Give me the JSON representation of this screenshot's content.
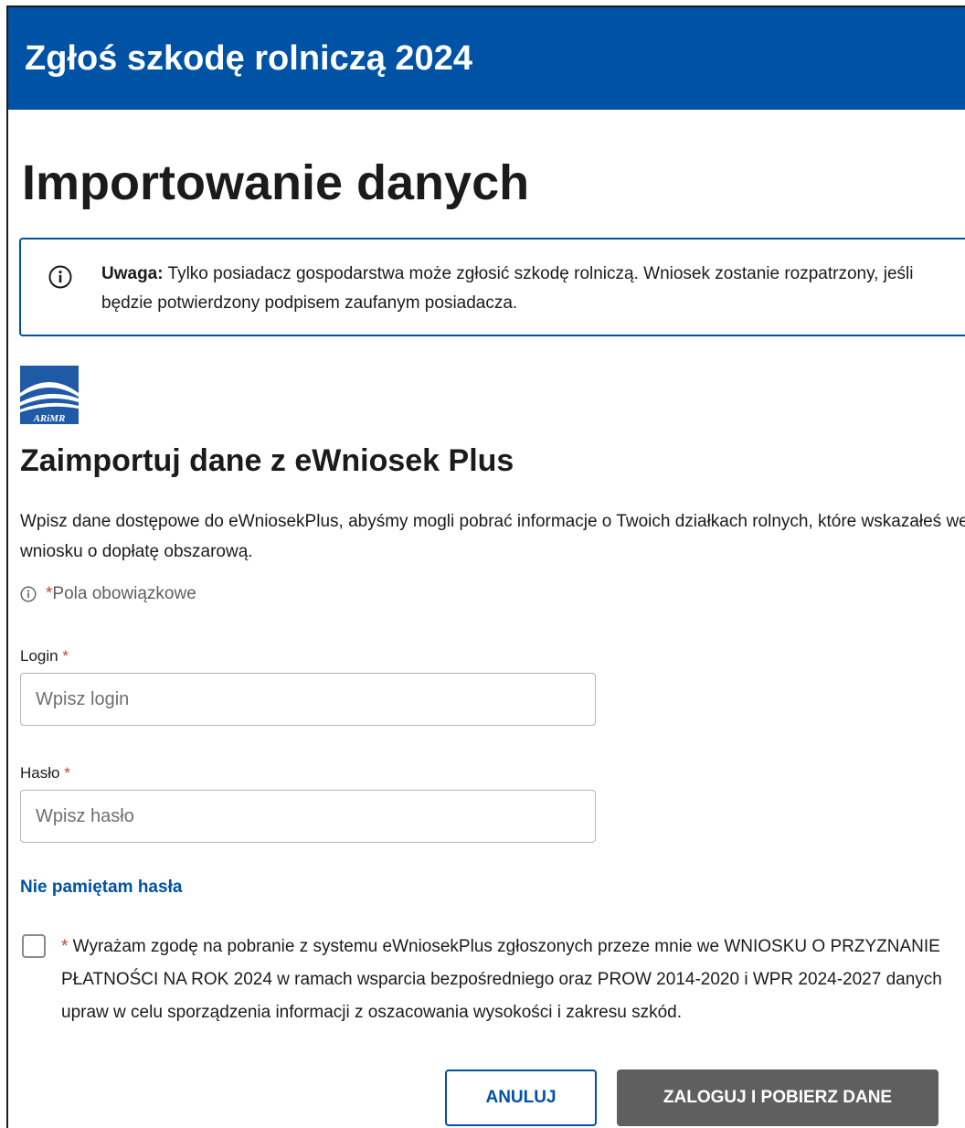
{
  "header": {
    "title": "Zgłoś szkodę rolniczą 2024",
    "color": "#0052a5"
  },
  "page": {
    "title": "Importowanie danych"
  },
  "alert": {
    "label": "Uwaga:",
    "text": " Tylko posiadacz gospodarstwa może zgłosić szkodę rolniczą. Wniosek zostanie rozpatrzony, jeśli będzie potwierdzony podpisem zaufanym posiadacza.",
    "icon": "info-icon"
  },
  "logo": {
    "text": "ARiMR",
    "icon": "arimr-logo"
  },
  "section": {
    "title": "Zaimportuj dane z eWniosek Plus",
    "intro": "Wpisz dane dostępowe do eWniosekPlus, abyśmy mogli pobrać informacje o Twoich działkach rolnych, które wskazałeś we wniosku o dopłatę obszarową."
  },
  "required_note": {
    "star": "*",
    "text": " Pola obowiązkowe"
  },
  "form": {
    "login": {
      "label": "Login",
      "star": "*",
      "value": "",
      "placeholder": "Wpisz login"
    },
    "password": {
      "label": "Hasło",
      "star": "*",
      "value": "",
      "placeholder": "Wpisz hasło"
    },
    "forgot_link": "Nie pamiętam hasła",
    "consent": {
      "checked": false,
      "star": "*",
      "text": " Wyrażam zgodę na pobranie z systemu eWniosekPlus zgłoszonych przeze mnie we WNIOSKU O PRZYZNANIE PŁATNOŚCI NA ROK 2024 w ramach wsparcia bezpośredniego oraz PROW 2014-2020 i WPR 2024-2027 danych upraw w celu sporządzenia informacji z oszacowania wysokości i zakresu szkód."
    }
  },
  "buttons": {
    "cancel": "ANULUJ",
    "submit": "ZALOGUJ I POBIERZ DANE"
  }
}
